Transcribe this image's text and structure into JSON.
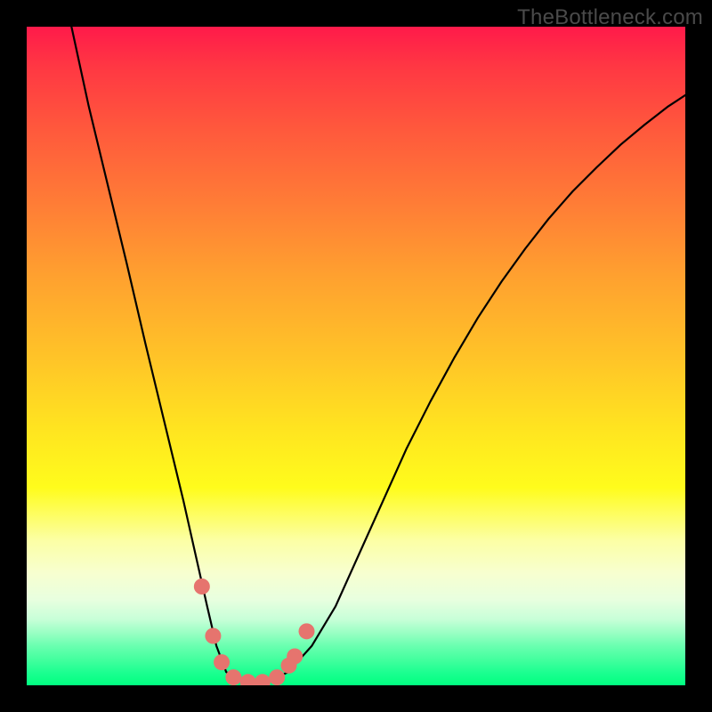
{
  "watermark": "TheBottleneck.com",
  "chart_data": {
    "type": "line",
    "title": "",
    "xlabel": "",
    "ylabel": "",
    "xlim": [
      0,
      1
    ],
    "ylim": [
      0,
      1
    ],
    "legend": false,
    "grid": false,
    "background_gradient": "red-orange-yellow-green top to bottom",
    "series": [
      {
        "name": "curve",
        "x": [
          0.068,
          0.094,
          0.123,
          0.152,
          0.18,
          0.209,
          0.238,
          0.256,
          0.274,
          0.288,
          0.303,
          0.332,
          0.361,
          0.397,
          0.433,
          0.469,
          0.505,
          0.541,
          0.577,
          0.613,
          0.649,
          0.685,
          0.721,
          0.757,
          0.793,
          0.829,
          0.866,
          0.902,
          0.938,
          0.974,
          1.0
        ],
        "y": [
          1.0,
          0.88,
          0.76,
          0.64,
          0.52,
          0.4,
          0.28,
          0.2,
          0.12,
          0.06,
          0.02,
          0.004,
          0.004,
          0.02,
          0.06,
          0.12,
          0.2,
          0.28,
          0.36,
          0.431,
          0.497,
          0.558,
          0.613,
          0.663,
          0.709,
          0.75,
          0.787,
          0.821,
          0.851,
          0.879,
          0.896
        ]
      }
    ],
    "markers": {
      "color": "#e6746e",
      "points_xy": [
        [
          0.266,
          0.15
        ],
        [
          0.283,
          0.075
        ],
        [
          0.296,
          0.035
        ],
        [
          0.314,
          0.012
        ],
        [
          0.336,
          0.005
        ],
        [
          0.358,
          0.005
        ],
        [
          0.38,
          0.012
        ],
        [
          0.398,
          0.03
        ],
        [
          0.407,
          0.044
        ],
        [
          0.425,
          0.082
        ]
      ]
    }
  }
}
